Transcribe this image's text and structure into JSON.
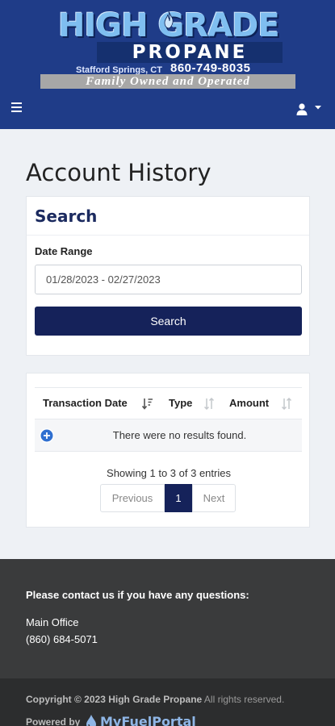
{
  "header": {
    "logo": {
      "title": "HIGH GRADE",
      "subtitle": "PROPANE",
      "location": "Stafford Springs, CT",
      "phone": "860-749-8035",
      "tagline": "Family Owned and Operated"
    },
    "menu_icon": "hamburger-menu-icon",
    "user_icon": "user-icon"
  },
  "page": {
    "title": "Account History"
  },
  "search": {
    "heading": "Search",
    "date_label": "Date Range",
    "date_value": "01/28/2023 - 02/27/2023",
    "button_label": "Search"
  },
  "results": {
    "columns": [
      "Transaction Date",
      "Type",
      "Amount"
    ],
    "empty_message": "There were no results found.",
    "entries_info": "Showing 1 to 3 of 3 entries",
    "pagination": {
      "previous": "Previous",
      "current": "1",
      "next": "Next"
    }
  },
  "footer": {
    "contact_heading": "Please contact us if you have any questions:",
    "office_name": "Main Office",
    "office_phone": "(860) 684-5071",
    "copyright_company": "Copyright © 2023 High Grade Propane",
    "copyright_rest": " All rights reserved.",
    "powered_by": "Powered by",
    "brand": "MyFuelPortal"
  },
  "colors": {
    "header_bg": "#1f3c88",
    "primary_button": "#15225a",
    "heading_text": "#1b2a5f",
    "expand_icon": "#2f6fd0",
    "footer_bg": "#3a3b3c"
  }
}
